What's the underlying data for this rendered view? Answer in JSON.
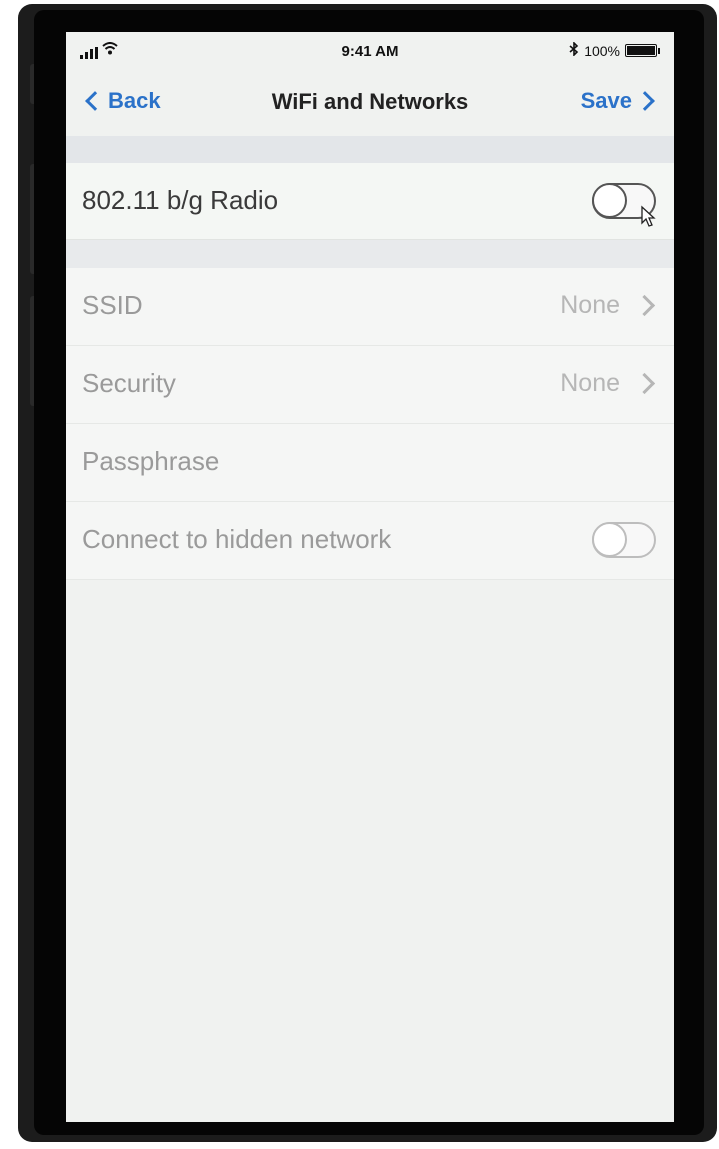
{
  "status_bar": {
    "time": "9:41 AM",
    "battery_text": "100%",
    "bluetooth_glyph": "✱",
    "wifi_glyph": "◠"
  },
  "nav": {
    "back_label": "Back",
    "title": "WiFi and Networks",
    "save_label": "Save"
  },
  "settings": {
    "radio": {
      "label": "802.11 b/g Radio",
      "enabled": false
    },
    "ssid": {
      "label": "SSID",
      "value": "None"
    },
    "security": {
      "label": "Security",
      "value": "None"
    },
    "passphrase": {
      "label": "Passphrase"
    },
    "hidden_network": {
      "label": "Connect to hidden network",
      "enabled": false
    }
  },
  "colors": {
    "accent": "#2b72c9",
    "disabled_text": "#9a9a9a",
    "screen_bg": "#f0f2f0"
  }
}
